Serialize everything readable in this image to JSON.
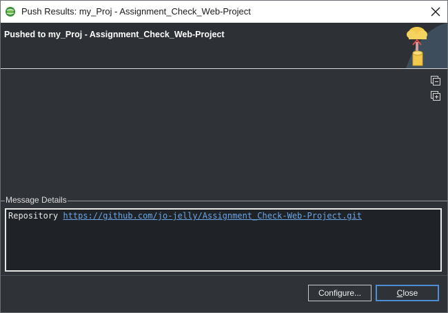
{
  "window": {
    "title": "Push Results: my_Proj - Assignment_Check_Web-Project"
  },
  "header": {
    "title": "Pushed to my_Proj - Assignment_Check_Web-Project"
  },
  "toolbar": {
    "collapse_icon": "collapse-all-icon",
    "expand_icon": "expand-all-icon"
  },
  "message_details": {
    "label": "Message Details",
    "prefix": "Repository",
    "link": "https://github.com/jo-jelly/Assignment_Check-Web-Project.git"
  },
  "buttons": {
    "configure": "Configure...",
    "close_mnemonic": "C",
    "close_rest": "lose"
  },
  "colors": {
    "accent": "#4d8fd6",
    "background": "#2f3337",
    "link": "#6aa5e6"
  }
}
